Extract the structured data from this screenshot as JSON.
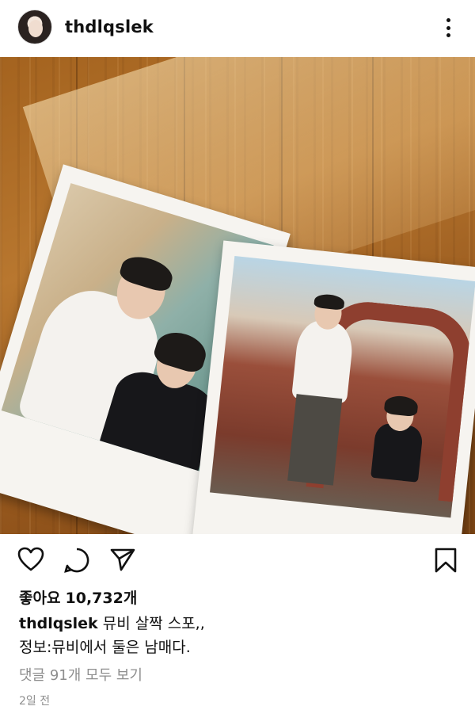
{
  "post": {
    "username": "thdlqslek",
    "likes_label": "좋아요",
    "likes_count": "10,732개",
    "caption_user": "thdlqslek",
    "caption_line1": "뮤비 살짝 스포,,",
    "caption_line2": "정보:뮤비에서 둘은 남매다.",
    "view_comments": "댓글 91개 모두 보기",
    "time_ago": "2일 전"
  },
  "icons": {
    "more": "more-vertical-icon",
    "like": "heart-icon",
    "comment": "comment-icon",
    "share": "send-icon",
    "save": "bookmark-icon"
  },
  "colors": {
    "text": "#111111",
    "muted": "#8e8e8e",
    "background": "#ffffff"
  }
}
